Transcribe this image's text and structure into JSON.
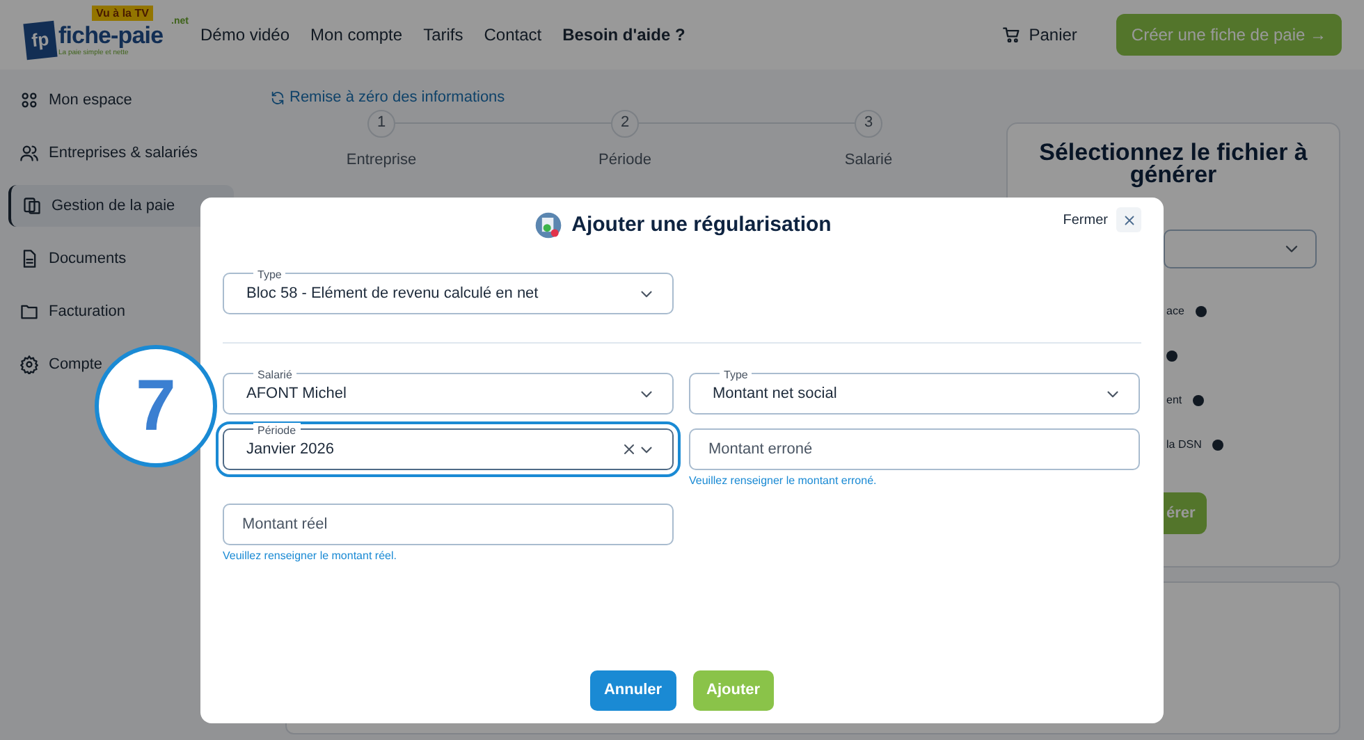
{
  "logo": {
    "name": "fiche-paie",
    "suffix": ".net",
    "badge": "Vu à la TV",
    "tagline": "La paie simple et nette",
    "mark": "fp"
  },
  "nav": [
    {
      "label": "Démo vidéo",
      "bold": false
    },
    {
      "label": "Mon compte",
      "bold": false
    },
    {
      "label": "Tarifs",
      "bold": false
    },
    {
      "label": "Contact",
      "bold": false
    },
    {
      "label": "Besoin d'aide ?",
      "bold": true
    }
  ],
  "cart": "Panier",
  "create_button": "Créer une fiche de paie →",
  "sidebar": {
    "items": [
      {
        "label": "Mon espace",
        "selected": false
      },
      {
        "label": "Entreprises & salariés",
        "selected": false
      },
      {
        "label": "Gestion de la paie",
        "selected": true
      },
      {
        "label": "Documents",
        "selected": false
      },
      {
        "label": "Facturation",
        "selected": false
      },
      {
        "label": "Compte",
        "selected": false
      }
    ]
  },
  "reset_link": "Remise à zéro des informations",
  "steps": [
    {
      "number": "1",
      "label": "Entreprise"
    },
    {
      "number": "2",
      "label": "Période"
    },
    {
      "number": "3",
      "label": "Salarié"
    }
  ],
  "file_panel": {
    "title": "Sélectionnez le fichier à",
    "title_line_2": "générer",
    "options": [
      "ace",
      "ent",
      "la DSN"
    ],
    "button": "érer"
  },
  "dialog": {
    "title": "Ajouter une régularisation",
    "close": "Fermer",
    "type_field": {
      "label": "Type",
      "value": "Bloc 58 - Elément de revenu calculé en net"
    },
    "fields": [
      {
        "kind": "select",
        "label": "Salarié",
        "value": "AFONT Michel",
        "focused": false,
        "clearable": false
      },
      {
        "kind": "select",
        "label": "Type",
        "value": "Montant net social",
        "focused": false,
        "clearable": false
      },
      {
        "kind": "select",
        "label": "Période",
        "value": "Janvier 2026",
        "focused": true,
        "clearable": true
      },
      {
        "kind": "input",
        "placeholder": "Montant erroné",
        "error": "Veuillez renseigner le montant erroné.",
        "focused": false
      },
      {
        "kind": "input",
        "placeholder": "Montant réel",
        "error": "Veuillez renseigner le montant réel.",
        "focused": false
      }
    ],
    "buttons": [
      {
        "label": "Annuler",
        "kind": "secondary"
      },
      {
        "label": "Ajouter",
        "kind": "primary"
      }
    ]
  },
  "step_badge": "7"
}
